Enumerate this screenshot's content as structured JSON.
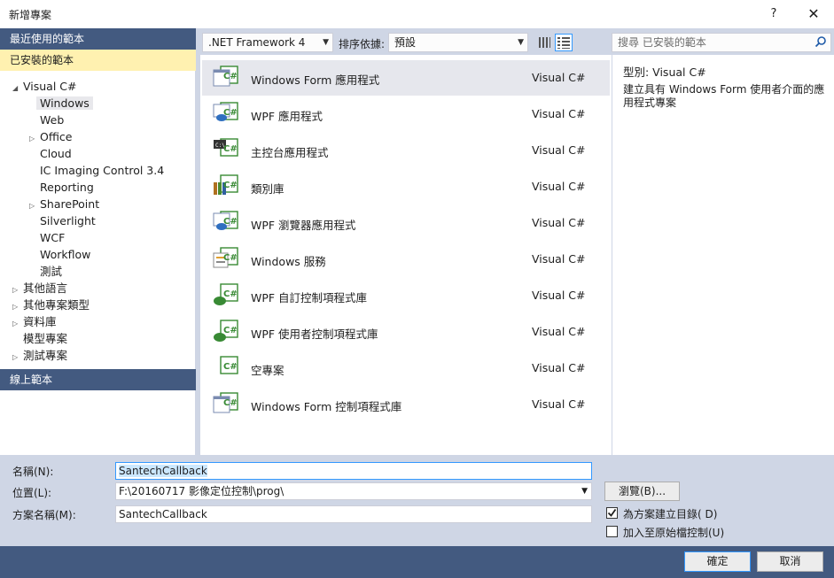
{
  "window": {
    "title": "新增專案",
    "help": "?",
    "close": "✕"
  },
  "left": {
    "recent": "最近使用的範本",
    "installed": "已安裝的範本",
    "online": "線上範本",
    "tree": [
      {
        "label": "Visual C#",
        "arrow": "◢",
        "level": 0
      },
      {
        "label": "Windows",
        "arrow": "",
        "level": 1
      },
      {
        "label": "Web",
        "arrow": "",
        "level": 1
      },
      {
        "label": "Office",
        "arrow": "▷",
        "level": 1
      },
      {
        "label": "Cloud",
        "arrow": "",
        "level": 1
      },
      {
        "label": "IC Imaging Control 3.4",
        "arrow": "",
        "level": 1
      },
      {
        "label": "Reporting",
        "arrow": "",
        "level": 1
      },
      {
        "label": "SharePoint",
        "arrow": "▷",
        "level": 1
      },
      {
        "label": "Silverlight",
        "arrow": "",
        "level": 1
      },
      {
        "label": "WCF",
        "arrow": "",
        "level": 1
      },
      {
        "label": "Workflow",
        "arrow": "",
        "level": 1
      },
      {
        "label": "測試",
        "arrow": "",
        "level": 1
      },
      {
        "label": "其他語言",
        "arrow": "▷",
        "level": 0
      },
      {
        "label": "其他專案類型",
        "arrow": "▷",
        "level": 0
      },
      {
        "label": "資料庫",
        "arrow": "▷",
        "level": 0
      },
      {
        "label": "模型專案",
        "arrow": "",
        "level": 0
      },
      {
        "label": "測試專案",
        "arrow": "▷",
        "level": 0
      }
    ]
  },
  "toolbar": {
    "framework": ".NET Framework 4",
    "sort_label": "排序依據:",
    "sort_value": "預設",
    "search_placeholder": "搜尋 已安裝的範本"
  },
  "templates": [
    {
      "name": "Windows Form 應用程式",
      "lang": "Visual C#",
      "icon": "winform-icon"
    },
    {
      "name": "WPF 應用程式",
      "lang": "Visual C#",
      "icon": "wpf-icon"
    },
    {
      "name": "主控台應用程式",
      "lang": "Visual C#",
      "icon": "console-icon"
    },
    {
      "name": "類別庫",
      "lang": "Visual C#",
      "icon": "classlib-icon"
    },
    {
      "name": "WPF 瀏覽器應用程式",
      "lang": "Visual C#",
      "icon": "wpf-browser-icon"
    },
    {
      "name": "Windows 服務",
      "lang": "Visual C#",
      "icon": "service-icon"
    },
    {
      "name": "WPF 自訂控制項程式庫",
      "lang": "Visual C#",
      "icon": "wpf-custom-control-icon"
    },
    {
      "name": "WPF 使用者控制項程式庫",
      "lang": "Visual C#",
      "icon": "wpf-user-control-icon"
    },
    {
      "name": "空專案",
      "lang": "Visual C#",
      "icon": "empty-project-icon"
    },
    {
      "name": "Windows Form 控制項程式庫",
      "lang": "Visual C#",
      "icon": "winform-control-icon"
    }
  ],
  "info": {
    "type_label": "型別:  Visual C#",
    "description": "建立具有 Windows Form 使用者介面的應用程式專案"
  },
  "form": {
    "name_label": "名稱(N):",
    "name_value": "SantechCallback",
    "location_label": "位置(L):",
    "location_value": "F:\\20160717 影像定位控制\\prog\\",
    "solution_label": "方案名稱(M):",
    "solution_value": "SantechCallback",
    "browse": "瀏覽(B)...",
    "create_dir": "為方案建立目錄( D)",
    "source_control": "加入至原始檔控制(U)"
  },
  "buttons": {
    "ok": "確定",
    "cancel": "取消"
  },
  "colors": {
    "accent": "#435a80",
    "selected": "#fff1b0",
    "csharp_green": "#388a34"
  }
}
